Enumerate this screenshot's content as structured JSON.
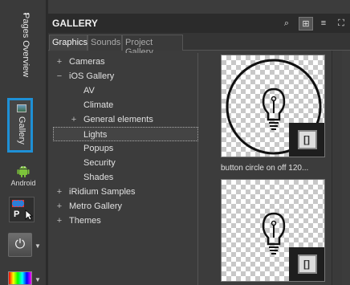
{
  "left_bar": {
    "pages_overview_label": "Pages Overview",
    "gallery_label": "Gallery",
    "android_label": "Android",
    "panel_button_letter": "P",
    "power_icon": "⏻",
    "dropdown_arrow": "▼"
  },
  "gallery": {
    "title": "GALLERY",
    "toolbar": {
      "search_icon": "⌕",
      "grid_icon": "⊞",
      "list_icon": "≡",
      "expand_icon": "⛶"
    },
    "tabs": [
      "Graphics",
      "Sounds",
      "Project Gallery"
    ],
    "tree": [
      {
        "label": "Cameras",
        "expander": "+",
        "level": 0
      },
      {
        "label": "iOS Gallery",
        "expander": "−",
        "level": 0
      },
      {
        "label": "AV",
        "expander": "",
        "level": 1
      },
      {
        "label": "Climate",
        "expander": "",
        "level": 1
      },
      {
        "label": "General elements",
        "expander": "+",
        "level": 1
      },
      {
        "label": "Lights",
        "expander": "",
        "level": 1
      },
      {
        "label": "Popups",
        "expander": "",
        "level": 1
      },
      {
        "label": "Security",
        "expander": "",
        "level": 1
      },
      {
        "label": "Shades",
        "expander": "",
        "level": 1
      },
      {
        "label": "iRidium Samples",
        "expander": "+",
        "level": 0
      },
      {
        "label": "Metro Gallery",
        "expander": "+",
        "level": 0
      },
      {
        "label": "Themes",
        "expander": "+",
        "level": 0
      }
    ],
    "thumbnails": [
      {
        "caption": "button circle on  off 120..."
      },
      {
        "caption": ""
      }
    ],
    "corner_badge_glyph": "[]"
  },
  "colors": {
    "gallery_tab_highlight": "#1e90d6",
    "panel_bg": "#3c3c3c",
    "title_bar_bg": "#2b2b2b"
  }
}
